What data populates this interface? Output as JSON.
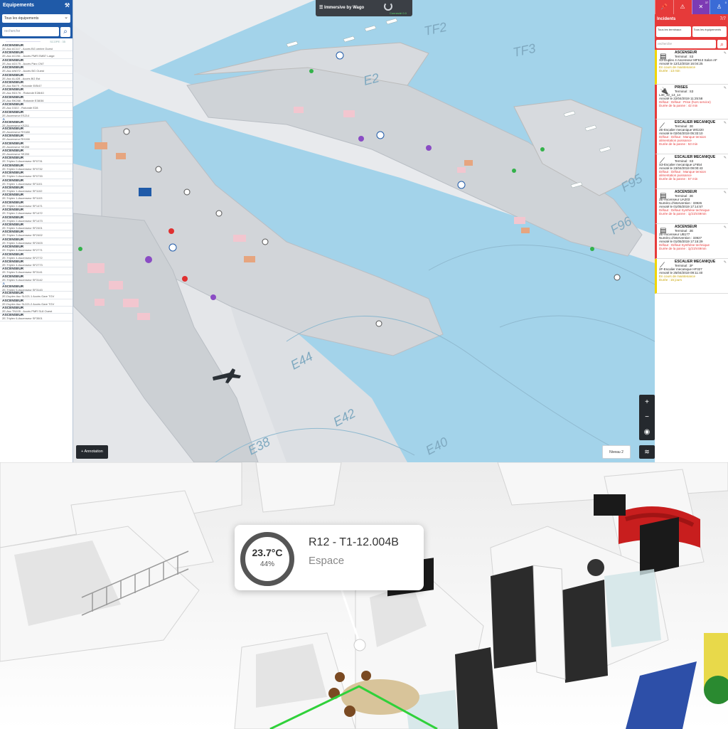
{
  "left_panel": {
    "title": "Equipements",
    "filter": "Tous les équipements",
    "search_placeholder": "recherche",
    "scope": "SCOPE : 35",
    "items": [
      {
        "title": "ASCENSEUR",
        "sub": "2E-Asc AC117 - Accès BG centre Ouest"
      },
      {
        "title": "ASCENSEUR",
        "sub": "2E-Asc AC261 - Accès PMR EMB7 Large"
      },
      {
        "title": "ASCENSEUR",
        "sub": "2E-Asc AD175 - Accès Parc CN7"
      },
      {
        "title": "ASCENSEUR",
        "sub": "2E-Asc AN072 - Accès BG Ouest"
      },
      {
        "title": "ASCENSEUR",
        "sub": "2E-Asc AL428 - Accès BG Est"
      },
      {
        "title": "ASCENSEUR",
        "sub": "2E-Asc BA79 - Rotonde E/B/47"
      },
      {
        "title": "ASCENSEUR",
        "sub": "2E-Asc BD176 - Rotonde E28/40"
      },
      {
        "title": "ASCENSEUR",
        "sub": "2E-Asc BK268 - Rotonde E38/36"
      },
      {
        "title": "ASCENSEUR",
        "sub": "2E-Asc D322 - Rotonde E28"
      },
      {
        "title": "ASCENSEUR",
        "sub": "2E-Ascenseur ES214"
      },
      {
        "title": "ASCENSEUR",
        "sub": "2E-Ascenseur KS211",
        "icon": true
      },
      {
        "title": "ASCENSEUR",
        "sub": "2E-Ascenseur RH188"
      },
      {
        "title": "ASCENSEUR",
        "sub": "2E-Ascenseur RH198"
      },
      {
        "title": "ASCENSEUR",
        "sub": "2E-Ascenseur SE200"
      },
      {
        "title": "ASCENSEUR",
        "sub": "2E-Ascenseur SE200"
      },
      {
        "title": "ASCENSEUR",
        "sub": "2E-Triplex 0-Ascenseur SF0731"
      },
      {
        "title": "ASCENSEUR",
        "sub": "2E-Triplex 0-Ascenseur SF0732"
      },
      {
        "title": "ASCENSEUR",
        "sub": "2E-Triplex 0-Ascenseur SF0733"
      },
      {
        "title": "ASCENSEUR",
        "sub": "2E-Triplex 1-Ascenseur SF1101"
      },
      {
        "title": "ASCENSEUR",
        "sub": "2E-Triplex 1-Ascenseur SF1102"
      },
      {
        "title": "ASCENSEUR",
        "sub": "2E-Triplex 1-Ascenseur SF1103"
      },
      {
        "title": "ASCENSEUR",
        "sub": "2E-Triplex 2-Ascenseur SF1471"
      },
      {
        "title": "ASCENSEUR",
        "sub": "2E-Triplex 2-Ascenseur SF1472"
      },
      {
        "title": "ASCENSEUR",
        "sub": "2E-Triplex 2-Ascenseur SF1473"
      },
      {
        "title": "ASCENSEUR",
        "sub": "2E-Triplex 3-Ascenseur SF2401"
      },
      {
        "title": "ASCENSEUR",
        "sub": "2E-Triplex 3-Ascenseur SF2402"
      },
      {
        "title": "ASCENSEUR",
        "sub": "2E-Triplex 3-Ascenseur SF2403"
      },
      {
        "title": "ASCENSEUR",
        "sub": "2E-Triplex 4-Ascenseur SF2771"
      },
      {
        "title": "ASCENSEUR",
        "sub": "2E-Triplex 4-Ascenseur SF2772"
      },
      {
        "title": "ASCENSEUR",
        "sub": "2E-Triplex 4-Ascenseur SF2773"
      },
      {
        "title": "ASCENSEUR",
        "sub": "2E-Triplex 5-Ascenseur SF3141"
      },
      {
        "title": "ASCENSEUR",
        "sub": "2E-Triplex 5-Ascenseur SF3142"
      },
      {
        "title": "ASCENSEUR",
        "sub": "2E-Triplex 5-Ascenseur SF3143",
        "icon": true
      },
      {
        "title": "ASCENSEUR",
        "sub": "2E-Duplex Asc SL021.1 Accès Gare TGV"
      },
      {
        "title": "ASCENSEUR",
        "sub": "2E-Duplex Asc SL021.2 Accès Gare TGV"
      },
      {
        "title": "ASCENSEUR",
        "sub": "2E-Asc TN105 - Accès PMR SL8 Ouest"
      },
      {
        "title": "ASCENSEUR",
        "sub": "2E-Triplex 6-Ascenseur SF3501"
      }
    ]
  },
  "map": {
    "title": "Immersive by Wago",
    "connection": "Connecté 0.0",
    "annotation_label": "+ Annotation",
    "level_label": "Niveau 2",
    "zoom_in": "+",
    "zoom_out": "−",
    "locate": "◉",
    "layers": "≋",
    "water_color": "#a3d3ea",
    "labels": [
      {
        "text": "TF2"
      },
      {
        "text": "TF3"
      },
      {
        "text": "E2"
      },
      {
        "text": "F96"
      },
      {
        "text": "F95"
      },
      {
        "text": "E44"
      },
      {
        "text": "E42"
      },
      {
        "text": "E40"
      },
      {
        "text": "E38"
      }
    ]
  },
  "right_panel": {
    "top_icons": [
      {
        "icon": "pin-icon",
        "glyph": "📌",
        "count": ""
      },
      {
        "icon": "warning-icon",
        "glyph": "⚠",
        "count": ""
      },
      {
        "icon": "tools-icon",
        "glyph": "✕",
        "count": "37"
      },
      {
        "icon": "person-icon",
        "glyph": "♙",
        "count": "0"
      }
    ],
    "title": "Incidents",
    "count": "7/7",
    "filter_terminal": "Tous les terminaux",
    "filter_equipment": "Tous les équipements",
    "search_placeholder": "recherche",
    "incidents": [
      {
        "severity": "warn",
        "icon": "elevator-icon",
        "glyph": "▤",
        "title": "ASCENSEUR",
        "terminal": "Terminal : S3",
        "lines": [
          {
            "text": "S3-Duplex 4 Ascenseur MF613 Salon AF",
            "cls": ""
          },
          {
            "text": "Annoté le 12/12/2018 16:04:25",
            "cls": ""
          },
          {
            "text": "En cours de maintenance",
            "cls": "yellow"
          },
          {
            "text": "Durée : 13 min",
            "cls": "yellow"
          }
        ]
      },
      {
        "severity": "alert",
        "icon": "plug-icon",
        "glyph": "🔌",
        "title": "PRISES",
        "terminal": "Terminal : S3",
        "lines": [
          {
            "text": "L30_12_13_14",
            "cls": ""
          },
          {
            "text": "Annoté le 22/04/2019 11:25:58",
            "cls": ""
          },
          {
            "text": "Défaut : Défaut : Prise (hors service)",
            "cls": "red"
          },
          {
            "text": "Durée de la panne : 42 min",
            "cls": "red"
          }
        ]
      },
      {
        "severity": "alert",
        "icon": "escalator-icon",
        "glyph": "⟋",
        "title": "ESCALIER MECANIQUE",
        "terminal": "Terminal : 2E",
        "lines": [
          {
            "text": "2E-Escalier mecanique WG220",
            "cls": ""
          },
          {
            "text": "Annoté le 02/04/2019 05:33:10",
            "cls": ""
          },
          {
            "text": "Défaut : Défaut : Manque tension",
            "cls": "red"
          },
          {
            "text": "alimentation puissance",
            "cls": "red"
          },
          {
            "text": "Durée de la panne : 53 min",
            "cls": "red"
          }
        ]
      },
      {
        "severity": "alert",
        "icon": "escalator-icon",
        "glyph": "⟋",
        "title": "ESCALIER MECANIQUE",
        "terminal": "Terminal : S3",
        "lines": [
          {
            "text": "S3-Escalier mecanique LF654",
            "cls": ""
          },
          {
            "text": "Annoté le 23/04/2019 09:00:43",
            "cls": ""
          },
          {
            "text": "Défaut : Défaut : Manque tension",
            "cls": "red"
          },
          {
            "text": "alimentation puissance",
            "cls": "red"
          },
          {
            "text": "Durée de la panne : 57 min",
            "cls": "red"
          }
        ]
      },
      {
        "severity": "alert",
        "icon": "elevator-icon",
        "glyph": "▤",
        "title": "ASCENSEUR",
        "terminal": "Terminal : 2E",
        "lines": [
          {
            "text": "2E-Ascenseur UA203",
            "cls": ""
          },
          {
            "text": "Numéro d'intervention : 33926",
            "cls": ""
          },
          {
            "text": "Annoté le 01/05/2019 17:14:57",
            "cls": ""
          },
          {
            "text": "Défaut : Défaut Synthèse technique",
            "cls": "red"
          },
          {
            "text": "Durée de la panne : 1j/21h/49min",
            "cls": "red"
          }
        ]
      },
      {
        "severity": "alert",
        "icon": "elevator-icon",
        "glyph": "▤",
        "title": "ASCENSEUR",
        "terminal": "Terminal : 2E",
        "lines": [
          {
            "text": "2E-Ascenseur UB177",
            "cls": ""
          },
          {
            "text": "Numéro d'intervention : 33927",
            "cls": ""
          },
          {
            "text": "Annoté le 01/05/2019 17:15:29",
            "cls": ""
          },
          {
            "text": "Défaut : Défaut Synthèse technique",
            "cls": "red"
          },
          {
            "text": "Durée de la panne : 1j/21h/49min",
            "cls": "red"
          }
        ]
      },
      {
        "severity": "warn",
        "icon": "escalator-icon",
        "glyph": "⟋",
        "title": "ESCALIER MECANIQUE",
        "terminal": "Terminal : 2F",
        "lines": [
          {
            "text": "2F-Escalier mecanique HF327",
            "cls": ""
          },
          {
            "text": "Annoté le 25/04/2019 09:11:40",
            "cls": ""
          },
          {
            "text": "En cours de maintenance",
            "cls": "yellow"
          },
          {
            "text": "Durée : 15 jours",
            "cls": "yellow"
          }
        ]
      }
    ]
  },
  "scene": {
    "tooltip": {
      "temperature": "23.7°C",
      "humidity": "44%",
      "room": "R12 - T1-12.004B",
      "type": "Espace"
    }
  }
}
